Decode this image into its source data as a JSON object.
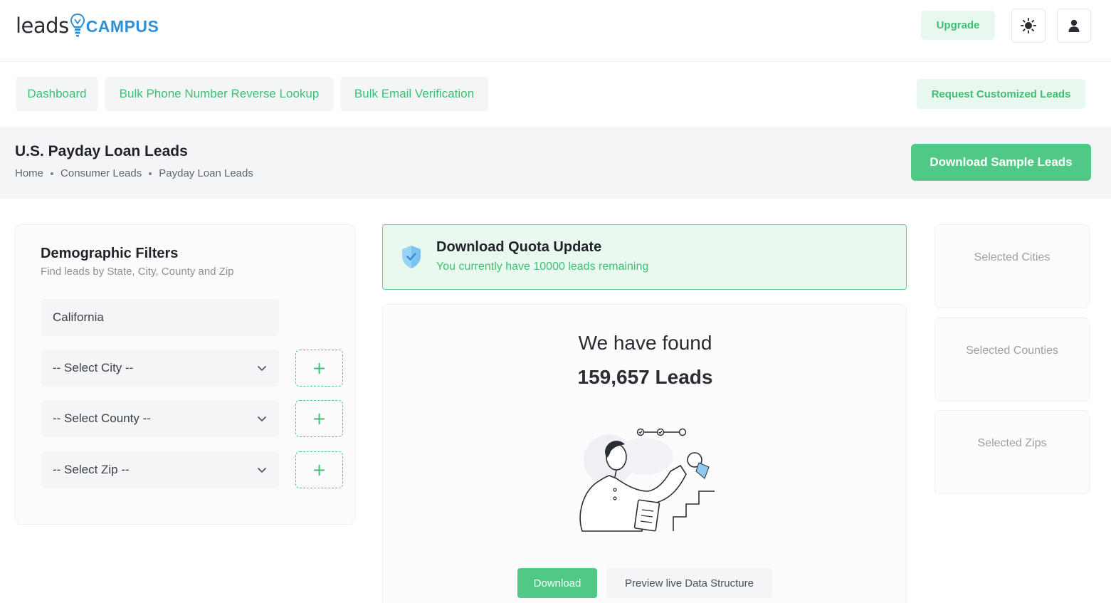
{
  "brand": {
    "logo_left": "leads",
    "logo_right": "CAMPUS"
  },
  "header": {
    "upgrade_label": "Upgrade",
    "theme_icon": "sun-icon",
    "user_icon": "user-icon"
  },
  "nav": {
    "items": [
      {
        "label": "Dashboard"
      },
      {
        "label": "Bulk Phone Number Reverse Lookup"
      },
      {
        "label": "Bulk Email Verification"
      }
    ],
    "request_label": "Request Customized Leads"
  },
  "page": {
    "title": "U.S. Payday Loan Leads",
    "breadcrumb": [
      "Home",
      "Consumer Leads",
      "Payday Loan Leads"
    ],
    "download_sample_label": "Download Sample Leads"
  },
  "filters": {
    "title": "Demographic Filters",
    "subtitle": "Find leads by State, City, County and Zip",
    "state_value": "California",
    "city_placeholder": "-- Select City --",
    "county_placeholder": "-- Select County --",
    "zip_placeholder": "-- Select Zip --",
    "add_symbol": "+"
  },
  "quota": {
    "title": "Download Quota Update",
    "message": "You currently have 10000 leads remaining",
    "icon": "shield-check-icon"
  },
  "results": {
    "found_label": "We have found",
    "found_count": "159,657 Leads",
    "download_label": "Download",
    "preview_label": "Preview live Data Structure"
  },
  "selected": {
    "cities": "Selected Cities",
    "counties": "Selected Counties",
    "zips": "Selected Zips"
  },
  "colors": {
    "accent": "#50c986",
    "accent_text": "#3fbf74",
    "accent_soft": "#e8f8ee",
    "brand_blue": "#2f8fd6"
  }
}
